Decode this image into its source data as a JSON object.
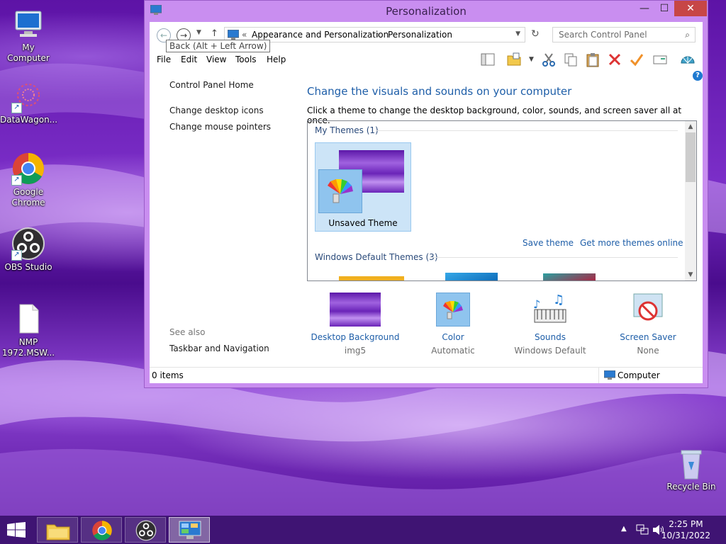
{
  "desktop": {
    "icons": [
      {
        "label": "My Computer",
        "icon": "computer-icon"
      },
      {
        "label": "DataWagon...",
        "icon": "datawagon-icon"
      },
      {
        "label": "Google Chrome",
        "icon": "chrome-icon"
      },
      {
        "label": "OBS Studio",
        "icon": "obs-icon"
      },
      {
        "label": "NMP 1972.MSW...",
        "icon": "file-icon"
      },
      {
        "label": "Recycle Bin",
        "icon": "recycle-bin-icon"
      }
    ]
  },
  "window": {
    "title": "Personalization",
    "close_glyph": "✕",
    "minimize_glyph": "—",
    "maximize_glyph": "☐",
    "address": {
      "overflow": "«",
      "crumbs": [
        "Appearance and Personalization",
        "Personalization"
      ],
      "separator": "›"
    },
    "search_placeholder": "Search Control Panel",
    "tooltip": "Back (Alt + Left Arrow)",
    "menu": [
      "File",
      "Edit",
      "View",
      "Tools",
      "Help"
    ],
    "left_pane": {
      "home": "Control Panel Home",
      "links": [
        "Change desktop icons",
        "Change mouse pointers"
      ],
      "see_also": "See also",
      "see_also_links": [
        "Taskbar and Navigation"
      ]
    },
    "main": {
      "title": "Change the visuals and sounds on your computer",
      "subtitle": "Click a theme to change the desktop background, color, sounds, and screen saver all at once.",
      "my_themes_label": "My Themes (1)",
      "selected_theme": "Unsaved Theme",
      "save_theme": "Save theme",
      "more_themes": "Get more themes online",
      "default_themes_label": "Windows Default Themes (3)"
    },
    "options": [
      {
        "label": "Desktop Background",
        "value": "img5",
        "icon": "desktop-background-icon"
      },
      {
        "label": "Color",
        "value": "Automatic",
        "icon": "color-icon"
      },
      {
        "label": "Sounds",
        "value": "Windows Default",
        "icon": "sounds-icon"
      },
      {
        "label": "Screen Saver",
        "value": "None",
        "icon": "screen-saver-icon"
      }
    ],
    "status": {
      "items": "0 items",
      "location": "Computer"
    }
  },
  "taskbar": {
    "time": "2:25 PM",
    "date": "10/31/2022",
    "apps": [
      "file-explorer",
      "google-chrome",
      "obs-studio",
      "control-panel"
    ],
    "accent": "#3c146e"
  }
}
